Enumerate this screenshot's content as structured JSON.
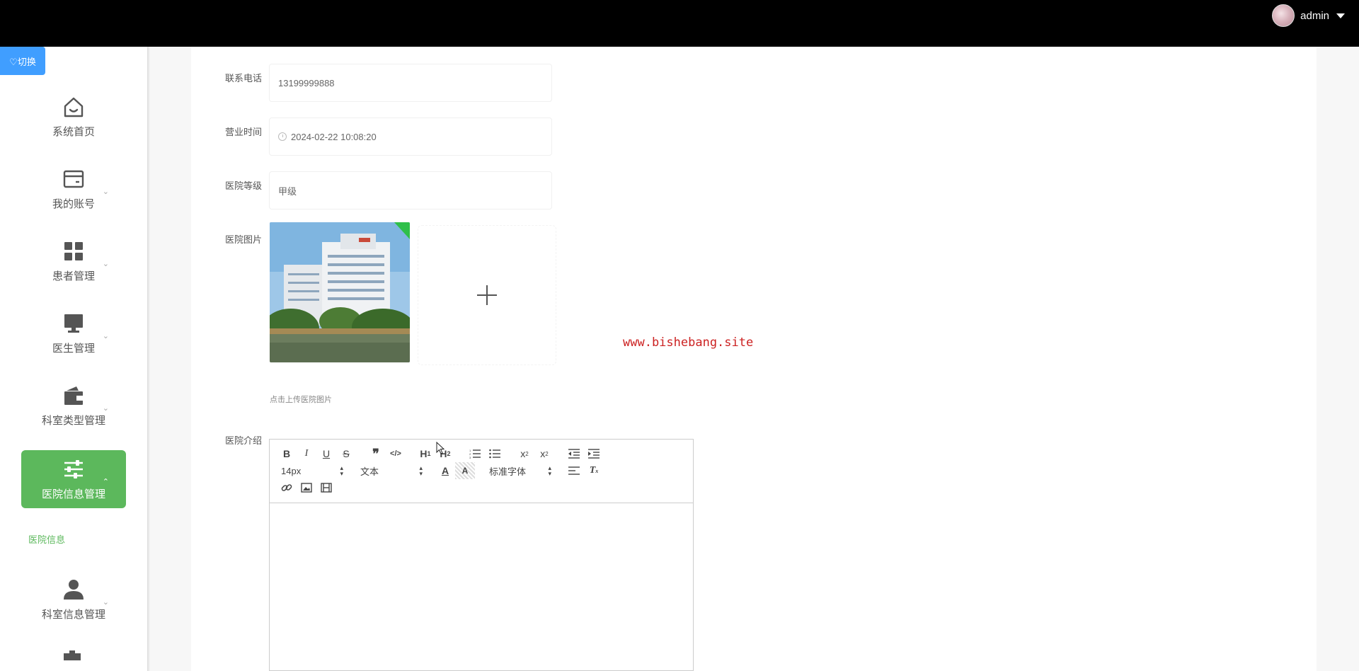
{
  "header": {
    "username": "admin"
  },
  "switch_button": {
    "label": "♡切换"
  },
  "sidebar": {
    "items": [
      {
        "label": "系统首页",
        "icon": "home-icon",
        "expandable": false
      },
      {
        "label": "我的账号",
        "icon": "wallet-icon",
        "expandable": true
      },
      {
        "label": "患者管理",
        "icon": "grid-icon",
        "expandable": true
      },
      {
        "label": "医生管理",
        "icon": "monitor-icon",
        "expandable": true
      },
      {
        "label": "科室类型管理",
        "icon": "purse-icon",
        "expandable": true
      },
      {
        "label": "医院信息管理",
        "icon": "sliders-icon",
        "expandable": true,
        "active": true
      },
      {
        "label": "科室信息管理",
        "icon": "user-icon",
        "expandable": true
      }
    ],
    "sub_items": [
      {
        "label": "医院信息"
      }
    ],
    "active_color": "#5cb85c"
  },
  "form": {
    "phone": {
      "label": "联系电话",
      "value": "13199999888"
    },
    "business_hours": {
      "label": "营业时间",
      "value": "2024-02-22 10:08:20"
    },
    "level": {
      "label": "医院等级",
      "value": "甲级"
    },
    "image": {
      "label": "医院图片",
      "hint": "点击上传医院图片"
    },
    "intro": {
      "label": "医院介绍"
    }
  },
  "editor": {
    "font_size": "14px",
    "heading": "文本",
    "font_family": "标准字体"
  },
  "watermark": "www.bishebang.site"
}
